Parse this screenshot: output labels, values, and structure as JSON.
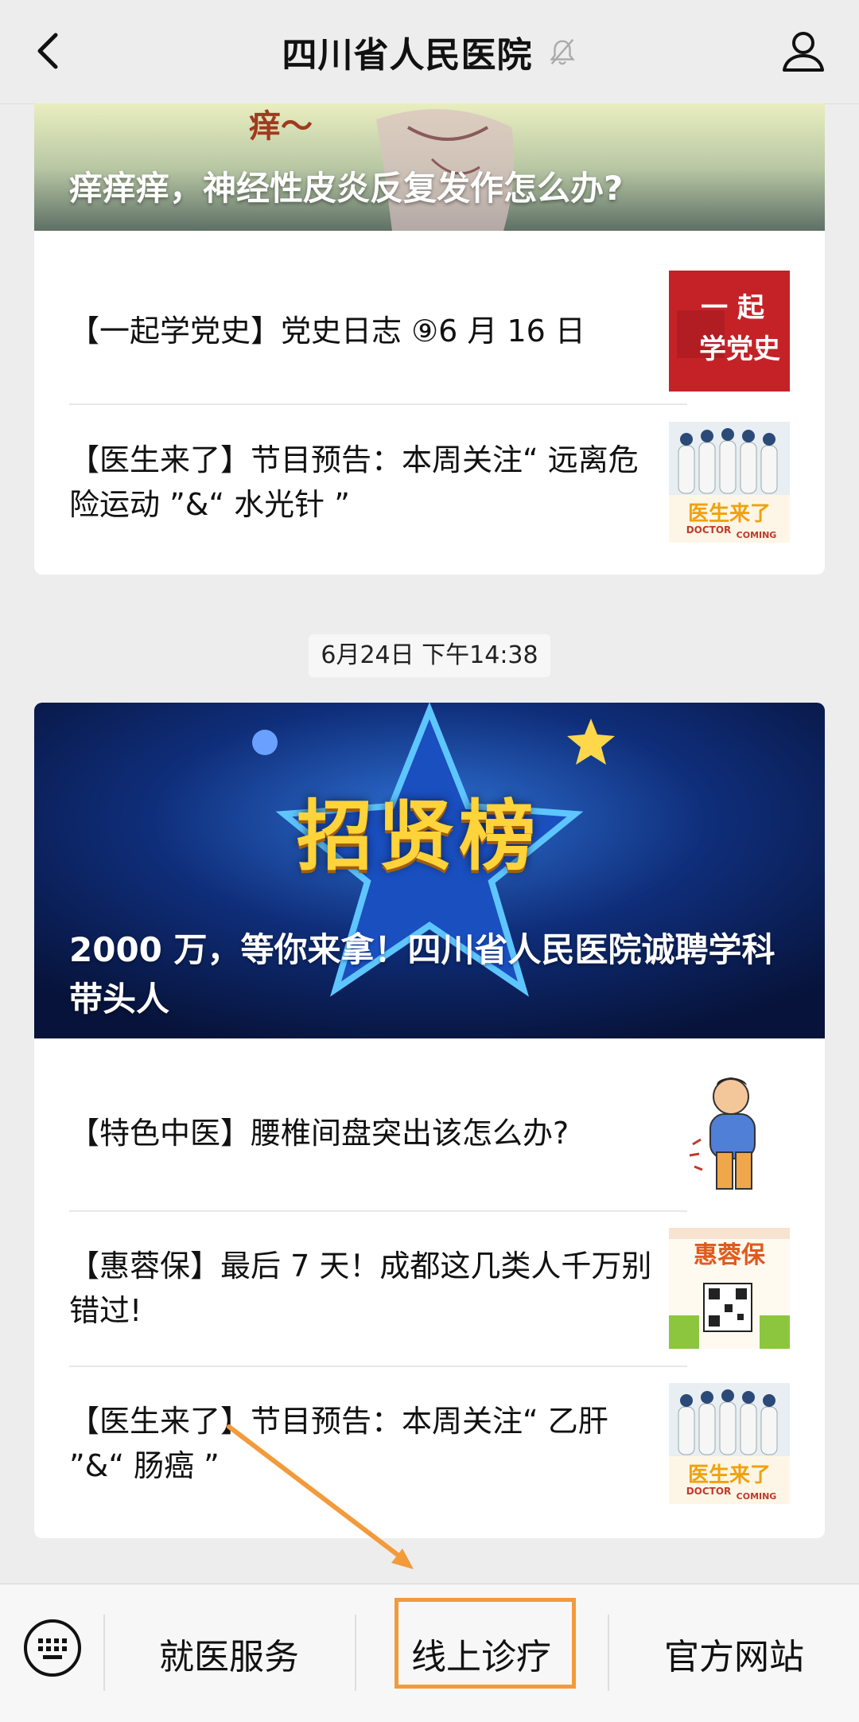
{
  "header": {
    "title": "四川省人民医院",
    "icons": [
      "back-arrow-icon",
      "mute-bell-icon",
      "profile-icon"
    ]
  },
  "card1": {
    "banner_title": "痒痒痒，神经性皮炎反复发作怎么办?",
    "banner_art_text": "痒～",
    "items": [
      {
        "title": "【一起学党史】党史日志 ⑨6 月 16 日",
        "thumb_text": "一 起\n学党史"
      },
      {
        "title": "【医生来了】节目预告：本周关注“ 远离危险运动 ”&“ 水光针 ”",
        "thumb_text": "医生来了"
      }
    ]
  },
  "timestamp": "6月24日 下午14:38",
  "card2": {
    "banner_title": "2000 万，等你来拿！四川省人民医院诚聘学科带头人",
    "banner_art_text": "招贤榜",
    "items": [
      {
        "title": "【特色中医】腰椎间盘突出该怎么办?"
      },
      {
        "title": "【惠蓉保】最后 7 天！成都这几类人千万别错过!",
        "thumb_text": "惠蓉保"
      },
      {
        "title": "【医生来了】节目预告：本周关注“ 乙肝 ”&“ 肠癌 ”",
        "thumb_text": "医生来了"
      }
    ]
  },
  "bottom_menu": {
    "items": [
      "就医服务",
      "线上诊疗",
      "官方网站"
    ],
    "highlighted": "线上诊疗",
    "highlight_color": "#f39a3a"
  }
}
